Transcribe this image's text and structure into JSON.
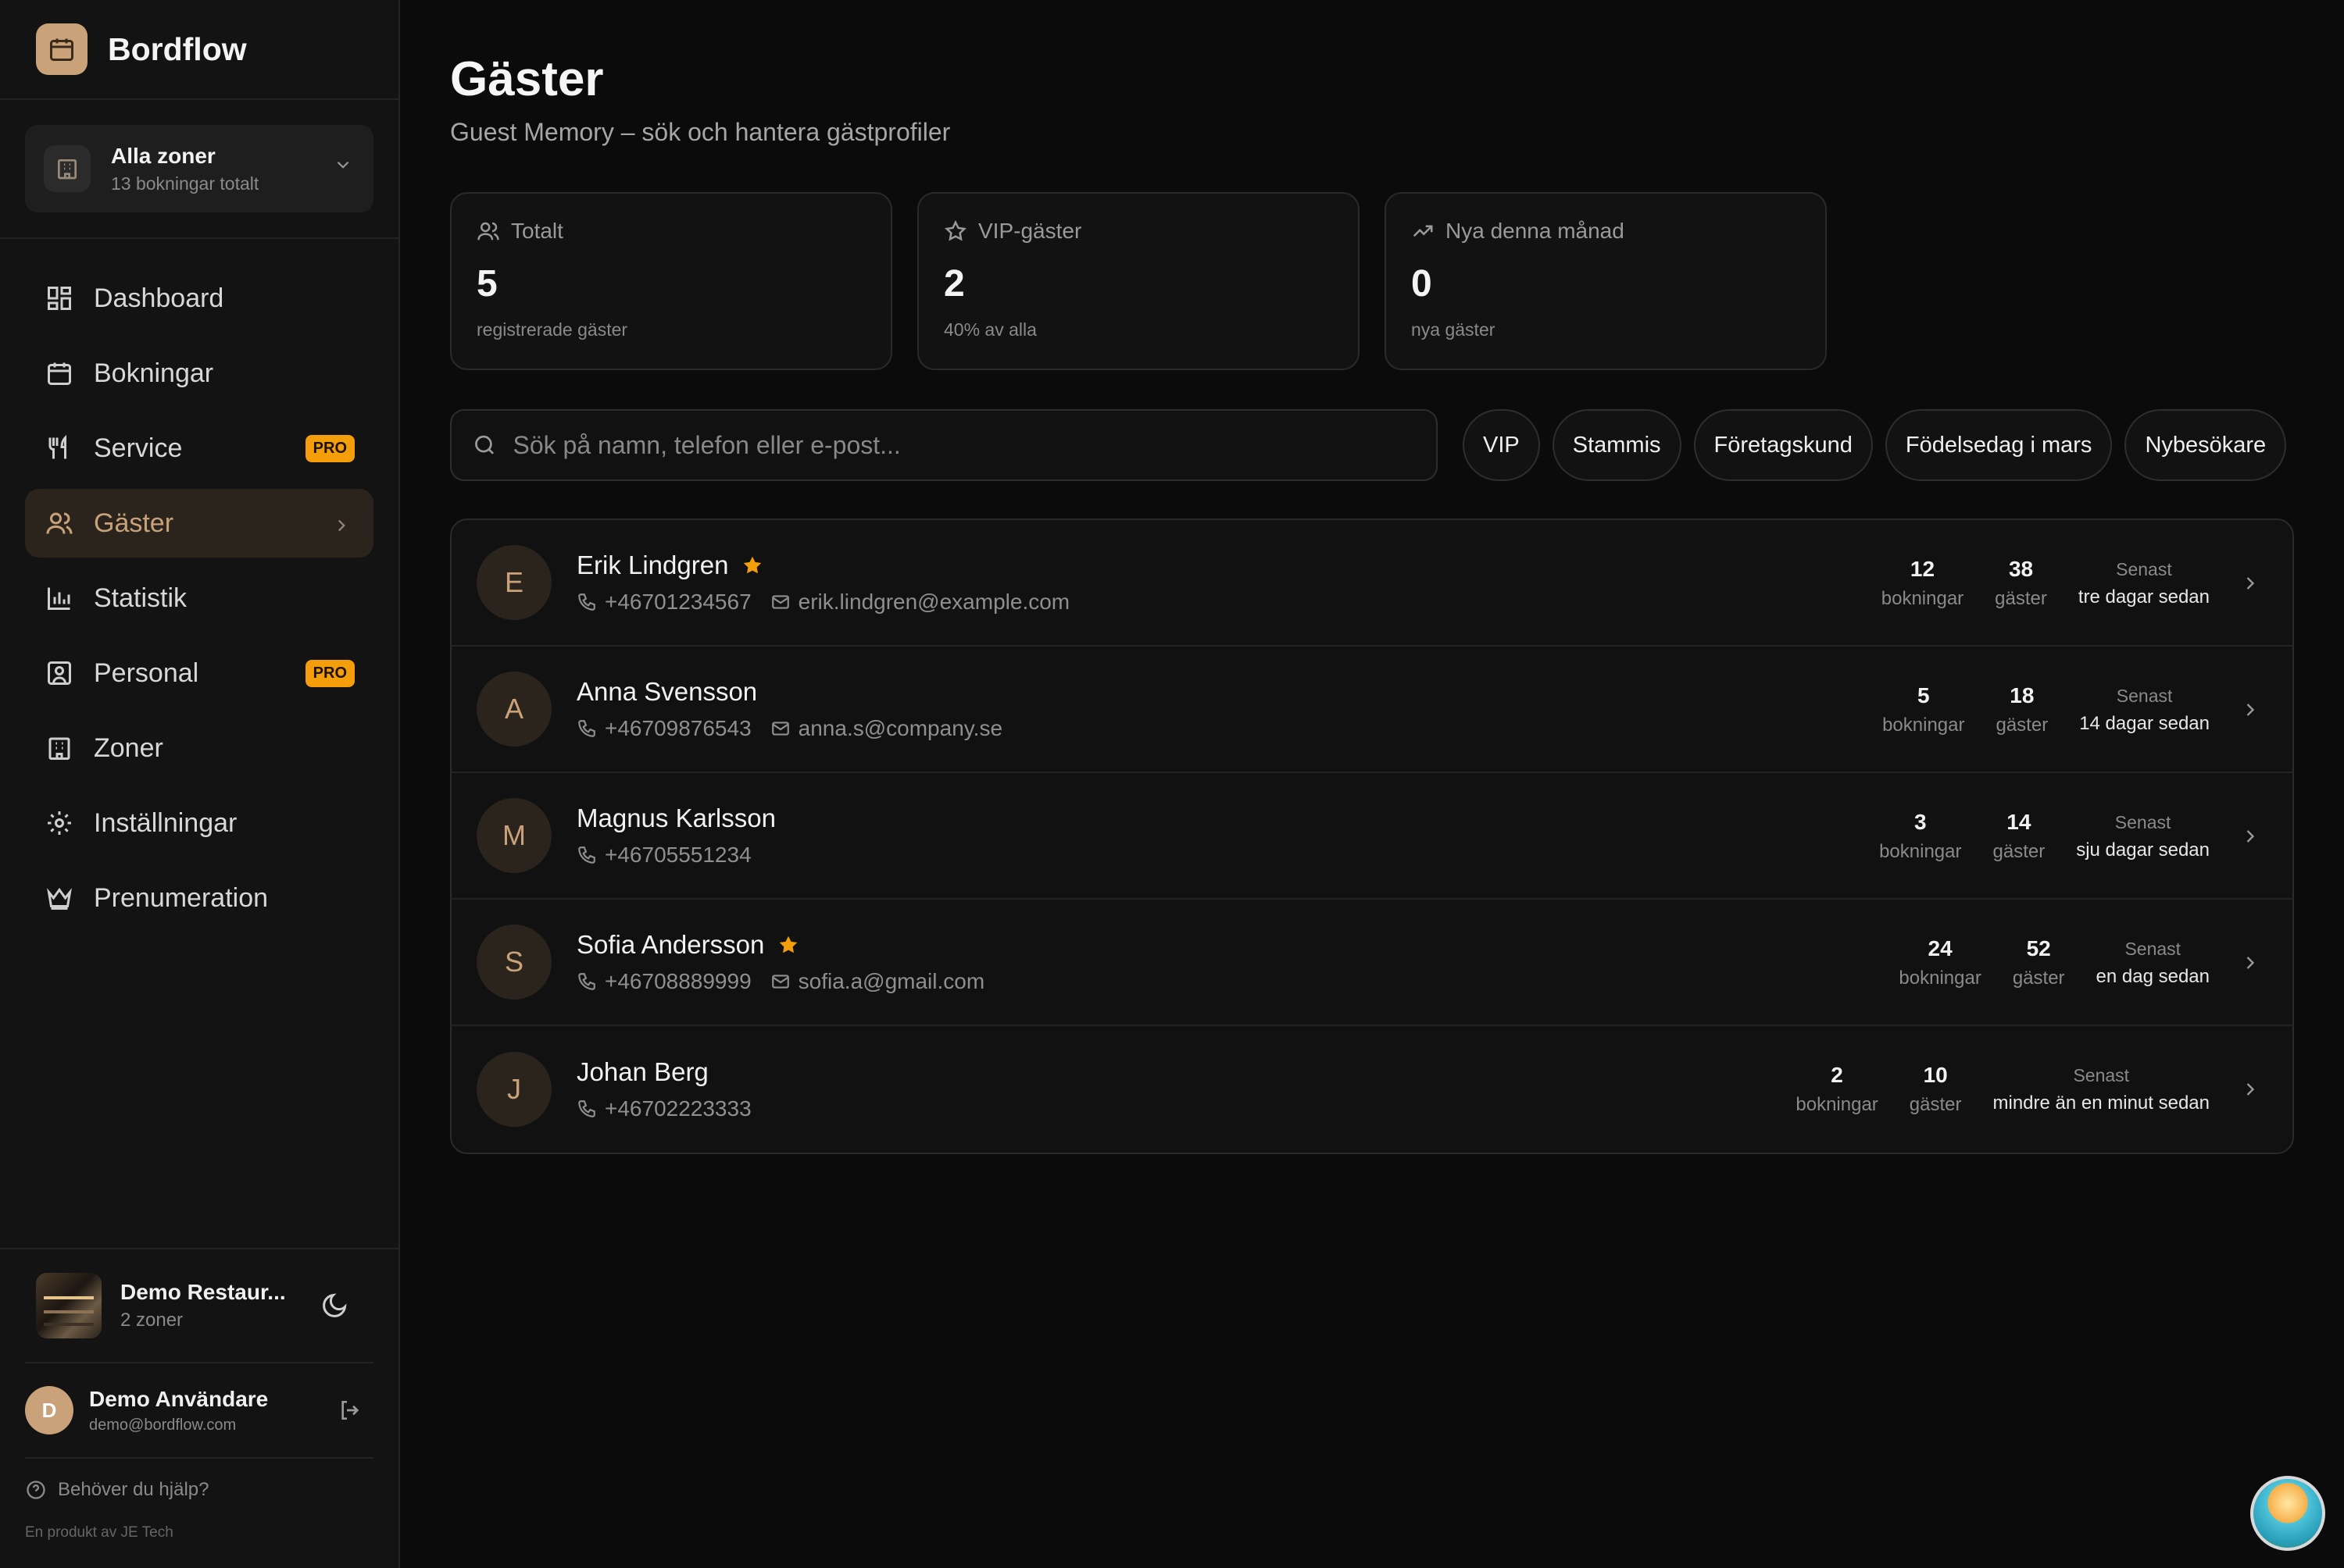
{
  "brand": {
    "name": "Bordflow"
  },
  "zone_selector": {
    "title": "Alla zoner",
    "subtitle": "13 bokningar totalt"
  },
  "nav": {
    "items": [
      {
        "label": "Dashboard",
        "icon": "dashboard-icon"
      },
      {
        "label": "Bokningar",
        "icon": "calendar-icon"
      },
      {
        "label": "Service",
        "icon": "utensils-icon",
        "badge": "PRO"
      },
      {
        "label": "Gäster",
        "icon": "users-icon",
        "active": true
      },
      {
        "label": "Statistik",
        "icon": "bar-chart-icon"
      },
      {
        "label": "Personal",
        "icon": "id-badge-icon",
        "badge": "PRO"
      },
      {
        "label": "Zoner",
        "icon": "building-icon"
      },
      {
        "label": "Inställningar",
        "icon": "gear-icon"
      },
      {
        "label": "Prenumeration",
        "icon": "crown-icon"
      }
    ]
  },
  "restaurant": {
    "name": "Demo Restaur...",
    "subtitle": "2 zoner"
  },
  "user": {
    "initial": "D",
    "name": "Demo Användare",
    "email": "demo@bordflow.com"
  },
  "help": {
    "label": "Behöver du hjälp?",
    "credit": "En produkt av JE Tech"
  },
  "page": {
    "title": "Gäster",
    "subtitle": "Guest Memory – sök och hantera gästprofiler"
  },
  "stats": [
    {
      "label": "Totalt",
      "value": "5",
      "sub": "registrerade gäster",
      "icon": "users-icon"
    },
    {
      "label": "VIP-gäster",
      "value": "2",
      "sub": "40% av alla",
      "icon": "star-icon"
    },
    {
      "label": "Nya denna månad",
      "value": "0",
      "sub": "nya gäster",
      "icon": "trending-up-icon"
    }
  ],
  "search": {
    "placeholder": "Sök på namn, telefon eller e-post..."
  },
  "filters": [
    "VIP",
    "Stammis",
    "Företagskund",
    "Födelsedag i mars",
    "Nybesökare"
  ],
  "guest_labels": {
    "bookings": "bokningar",
    "guests": "gäster",
    "last": "Senast"
  },
  "guests": [
    {
      "initial": "E",
      "name": "Erik Lindgren",
      "vip": true,
      "phone": "+46701234567",
      "email": "erik.lindgren@example.com",
      "bookings": "12",
      "guests": "38",
      "last": "tre dagar sedan"
    },
    {
      "initial": "A",
      "name": "Anna Svensson",
      "vip": false,
      "phone": "+46709876543",
      "email": "anna.s@company.se",
      "bookings": "5",
      "guests": "18",
      "last": "14 dagar sedan"
    },
    {
      "initial": "M",
      "name": "Magnus Karlsson",
      "vip": false,
      "phone": "+46705551234",
      "email": "",
      "bookings": "3",
      "guests": "14",
      "last": "sju dagar sedan"
    },
    {
      "initial": "S",
      "name": "Sofia Andersson",
      "vip": true,
      "phone": "+46708889999",
      "email": "sofia.a@gmail.com",
      "bookings": "24",
      "guests": "52",
      "last": "en dag sedan"
    },
    {
      "initial": "J",
      "name": "Johan Berg",
      "vip": false,
      "phone": "+46702223333",
      "email": "",
      "bookings": "2",
      "guests": "10",
      "last": "mindre än en minut sedan"
    }
  ],
  "colors": {
    "accent": "#c9a27a",
    "background": "#0b0b0b",
    "pro_badge": "#f59e0b",
    "vip_star": "#f59e0b"
  }
}
